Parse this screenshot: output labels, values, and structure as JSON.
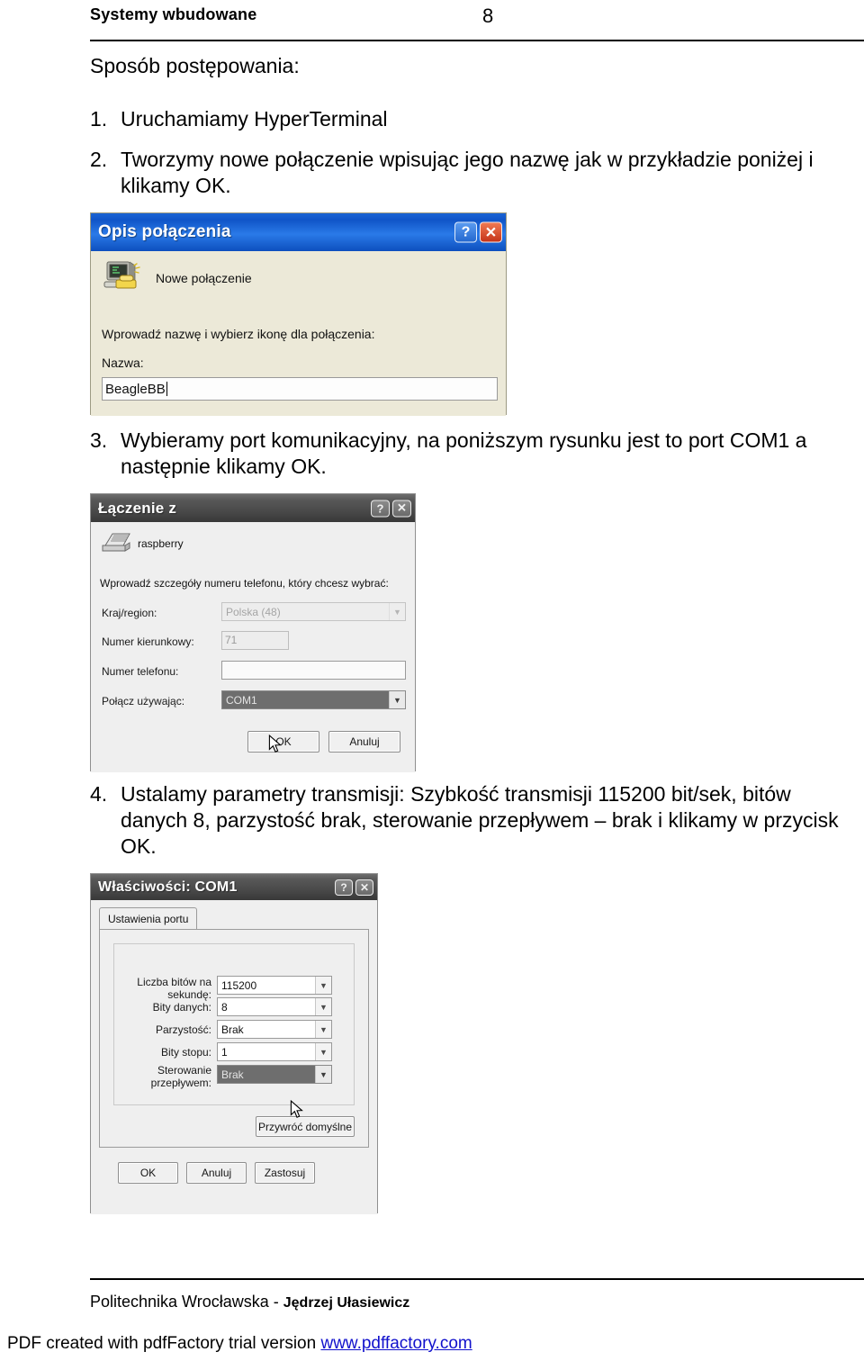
{
  "header": {
    "document_title": "Systemy wbudowane",
    "page_number": "8"
  },
  "content": {
    "lead": "Sposób postępowania:",
    "steps": [
      {
        "num": "1.",
        "text": "Uruchamiamy HyperTerminal"
      },
      {
        "num": "2.",
        "text": "Tworzymy nowe połączenie wpisując jego nazwę jak w przykładzie poniżej i klikamy OK."
      },
      {
        "num": "3.",
        "text": "Wybieramy port komunikacyjny, na poniższym rysunku jest to port COM1 a następnie klikamy OK."
      },
      {
        "num": "4.",
        "text": "Ustalamy parametry transmisji: Szybkość transmisji 115200 bit/sek, bitów danych 8, parzystość brak, sterowanie przepływem – brak i klikamy w przycisk OK."
      }
    ]
  },
  "dialog_connection_description": {
    "title": "Opis połączenia",
    "help_button": "?",
    "close_button": "✕",
    "icon_label": "Nowe połączenie",
    "instruction": "Wprowadź nazwę i wybierz ikonę dla połączenia:",
    "name_label": "Nazwa:",
    "name_value": "BeagleBB",
    "theme_titlebar_color": "#1055c8",
    "theme_body_color": "#ece9d8"
  },
  "dialog_connect_to": {
    "title": "Łączenie z",
    "help_button": "?",
    "close_button": "✕",
    "icon_label": "raspberry",
    "instruction": "Wprowadź szczegóły numeru telefonu, który chcesz wybrać:",
    "fields": [
      {
        "label": "Kraj/region:",
        "value": "Polska (48)",
        "state": "disabled",
        "type": "combo"
      },
      {
        "label": "Numer kierunkowy:",
        "value": "71",
        "state": "disabled",
        "type": "text"
      },
      {
        "label": "Numer telefonu:",
        "value": "",
        "state": "normal",
        "type": "text"
      },
      {
        "label": "Połącz używając:",
        "value": "COM1",
        "state": "selected",
        "type": "combo"
      }
    ],
    "ok_button": "OK",
    "cancel_button": "Anuluj",
    "theme_titlebar_color": "#4a4a4a",
    "theme_body_color": "#efefef"
  },
  "dialog_com1_properties": {
    "title": "Właściwości: COM1",
    "help_button": "?",
    "close_button": "✕",
    "tab_label": "Ustawienia portu",
    "fields": [
      {
        "label_line1": "Liczba bitów na",
        "label_line2": "sekundę:",
        "value": "115200",
        "state": "normal"
      },
      {
        "label_line1": "Bity danych:",
        "label_line2": "",
        "value": "8",
        "state": "normal"
      },
      {
        "label_line1": "Parzystość:",
        "label_line2": "",
        "value": "Brak",
        "state": "normal"
      },
      {
        "label_line1": "Bity stopu:",
        "label_line2": "",
        "value": "1",
        "state": "normal"
      },
      {
        "label_line1": "Sterowanie",
        "label_line2": "przepływem:",
        "value": "Brak",
        "state": "selected"
      }
    ],
    "restore_defaults_button": "Przywróć domyślne",
    "ok_button": "OK",
    "cancel_button": "Anuluj",
    "apply_button": "Zastosuj",
    "theme_titlebar_color": "#4a4a4a",
    "theme_body_color": "#efefef"
  },
  "footer": {
    "institution": "Politechnika Wrocławska - ",
    "author": "Jędrzej Ułasiewicz",
    "pdf_notice": "PDF created with pdfFactory trial version ",
    "pdf_link": "www.pdffactory.com"
  }
}
